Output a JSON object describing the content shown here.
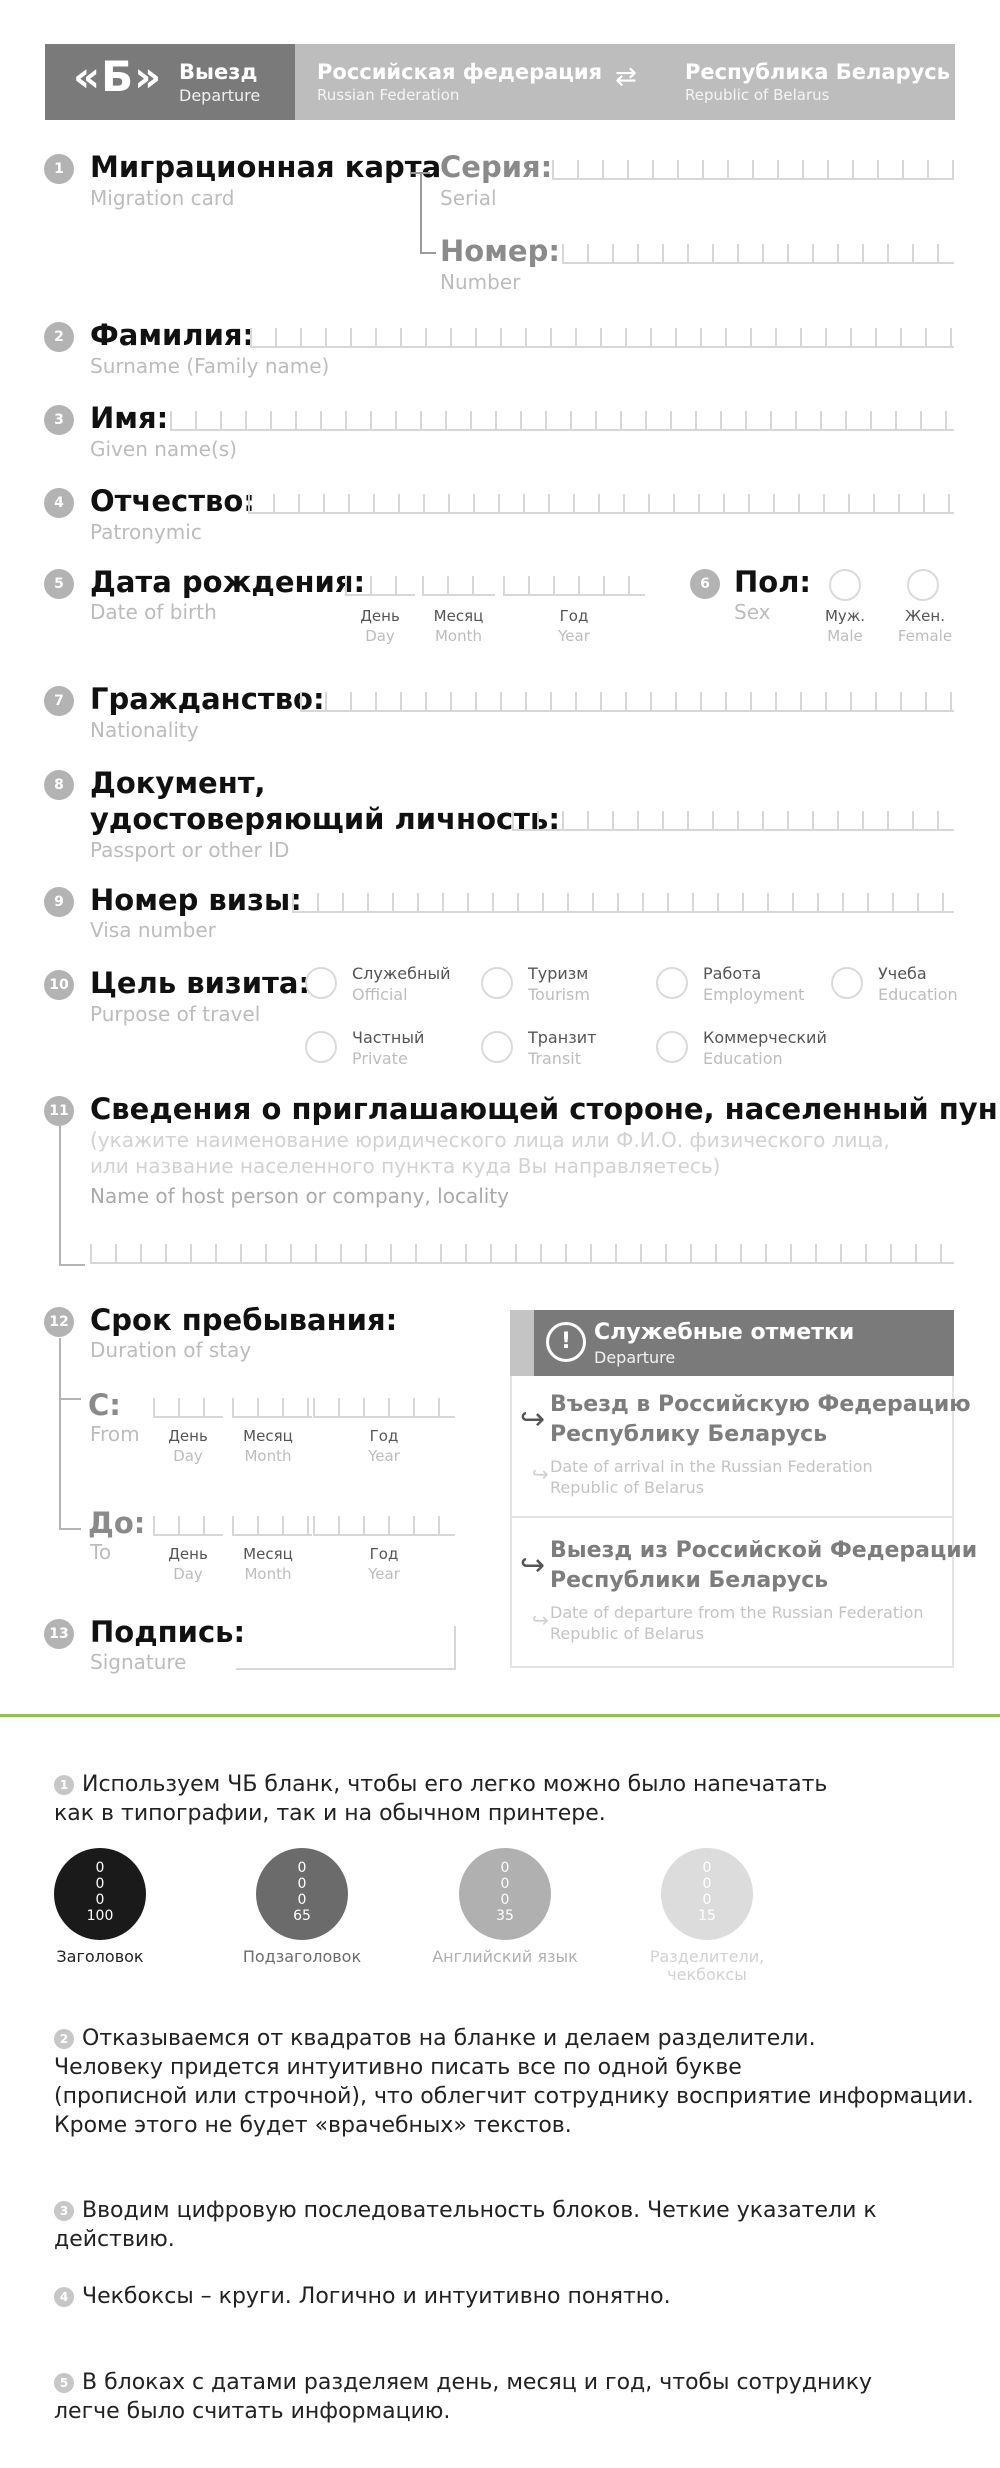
{
  "header": {
    "letter": "«Б»",
    "direction_ru": "Выезд",
    "direction_en": "Departure",
    "country1_ru": "Российская федерация",
    "country1_en": "Russian Federation",
    "arrow": "⇄",
    "country2_ru": "Республика Беларусь",
    "country2_en": "Republic of Belarus"
  },
  "fields": {
    "migration_card": {
      "num": "1",
      "ru": "Миграционная карта",
      "en": "Migration card"
    },
    "serial": {
      "ru": "Серия:",
      "en": "Serial"
    },
    "number": {
      "ru": "Номер:",
      "en": "Number"
    },
    "surname": {
      "num": "2",
      "ru": "Фамилия:",
      "en": "Surname (Family name)"
    },
    "name": {
      "num": "3",
      "ru": "Имя:",
      "en": "Given name(s)"
    },
    "patronymic": {
      "num": "4",
      "ru": "Отчество:",
      "en": "Patronymic"
    },
    "dob": {
      "num": "5",
      "ru": "Дата рождения:",
      "en": "Date of birth"
    },
    "sex": {
      "num": "6",
      "ru": "Пол:",
      "en": "Sex",
      "male_ru": "Муж.",
      "male_en": "Male",
      "female_ru": "Жен.",
      "female_en": "Female"
    },
    "nationality": {
      "num": "7",
      "ru": "Гражданство:",
      "en": "Nationality"
    },
    "document": {
      "num": "8",
      "ru1": "Документ,",
      "ru2": "удостоверяющий личность:",
      "en": "Passport or other ID"
    },
    "visa": {
      "num": "9",
      "ru": "Номер визы:",
      "en": "Visa number"
    },
    "purpose": {
      "num": "10",
      "ru": "Цель визита:",
      "en": "Purpose of travel",
      "options": [
        {
          "ru": "Служебный",
          "en": "Official"
        },
        {
          "ru": "Туризм",
          "en": "Tourism"
        },
        {
          "ru": "Работа",
          "en": "Employment"
        },
        {
          "ru": "Учеба",
          "en": "Education"
        },
        {
          "ru": "Частный",
          "en": "Private"
        },
        {
          "ru": "Транзит",
          "en": "Transit"
        },
        {
          "ru": "Коммерческий",
          "en": "Education"
        }
      ]
    },
    "host": {
      "num": "11",
      "ru": "Сведения о приглашающей стороне, населенный пункт:",
      "hint1": "(укажите наименование юридического лица или Ф.И.О. физического лица,",
      "hint2": "или название населенного пункта куда Вы направляетесь)",
      "en": "Name of host person or company, locality"
    },
    "stay": {
      "num": "12",
      "ru": "Срок пребывания:",
      "en": "Duration of stay",
      "from_ru": "С:",
      "from_en": "From",
      "to_ru": "До:",
      "to_en": "To"
    },
    "signature": {
      "num": "13",
      "ru": "Подпись:",
      "en": "Signature"
    }
  },
  "date_labels": {
    "day_ru": "День",
    "day_en": "Day",
    "month_ru": "Месяц",
    "month_en": "Month",
    "year_ru": "Год",
    "year_en": "Year"
  },
  "official_marks": {
    "title_ru": "Служебные отметки",
    "title_en": "Departure",
    "icon": "exclamation-icon",
    "entry_ru1": "Въезд в Российскую Федерацию",
    "entry_ru2": "Республику Беларусь",
    "entry_en1": "Date of arrival in the Russian Federation",
    "entry_en2": "Republic of Belarus",
    "exit_ru1": "Выезд из Российской Федерации",
    "exit_ru2": "Республики Беларусь",
    "exit_en1": "Date of departure from the Russian Federation",
    "exit_en2": "Republic of Belarus"
  },
  "notes": {
    "n1": {
      "num": "1",
      "line1": "Используем ЧБ бланк, чтобы его легко можно было напечатать",
      "line2": "как в типографии, так и на обычном принтере."
    },
    "swatches": [
      {
        "c": "0",
        "m": "0",
        "y": "0",
        "k": "100",
        "label": "Заголовок",
        "color": "#1a1a1a"
      },
      {
        "c": "0",
        "m": "0",
        "y": "0",
        "k": "65",
        "label": "Подзаголовок",
        "color": "#6b6b6b"
      },
      {
        "c": "0",
        "m": "0",
        "y": "0",
        "k": "35",
        "label": "Английский язык",
        "color": "#b0b0b0"
      },
      {
        "c": "0",
        "m": "0",
        "y": "0",
        "k": "15",
        "label1": "Разделители,",
        "label2": "чекбоксы",
        "color": "#dcdcdc"
      }
    ],
    "n2": {
      "num": "2",
      "line1": "Отказываемся от квадратов на бланке и делаем разделители.",
      "line2": "Человеку придется интуитивно писать все по одной букве",
      "line3": "(прописной или строчной), что облегчит сотруднику восприятие информации.",
      "line4": "Кроме этого не будет «врачебных» текстов."
    },
    "n3": {
      "num": "3",
      "line1": "Вводим цифровую последовательность блоков. Четкие указатели к действию."
    },
    "n4": {
      "num": "4",
      "line1": "Чекбоксы – круги. Логично и интуитивно понятно."
    },
    "n5": {
      "num": "5",
      "line1": "В блоках с датами разделяем день, месяц и год, чтобы сотруднику",
      "line2": "легче было считать информацию."
    }
  }
}
